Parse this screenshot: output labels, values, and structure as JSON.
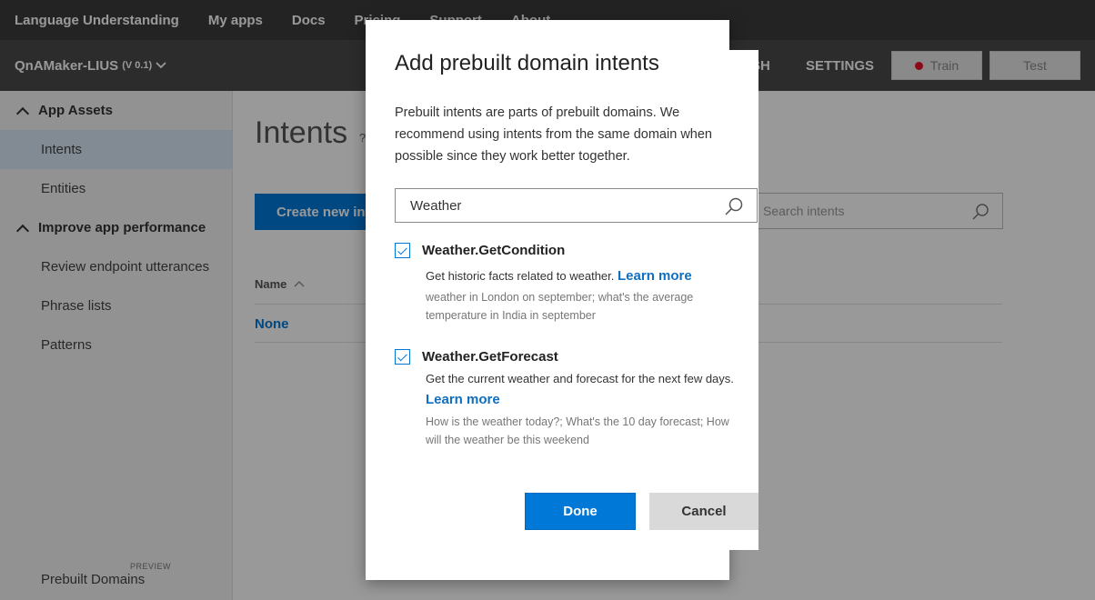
{
  "topnav": {
    "brand": "Language Understanding",
    "items": [
      "My apps",
      "Docs",
      "Pricing",
      "Support",
      "About"
    ]
  },
  "appbar": {
    "app_name": "QnAMaker-LIUS",
    "version": "(V 0.1)",
    "publish_partial": "SH",
    "settings": "SETTINGS",
    "train": "Train",
    "test": "Test"
  },
  "sidebar": {
    "groups": [
      {
        "label": "App Assets",
        "items": [
          "Intents",
          "Entities"
        ]
      },
      {
        "label": "Improve app performance",
        "items": [
          "Review endpoint utterances",
          "Phrase lists",
          "Patterns"
        ]
      }
    ],
    "prebuilt": "Prebuilt Domains",
    "preview_badge": "PREVIEW"
  },
  "main": {
    "title": "Intents",
    "help": "?",
    "create_button": "Create new intent",
    "search_placeholder": "Search intents",
    "column_name": "Name",
    "rows": [
      "None"
    ]
  },
  "dialog": {
    "title": "Add prebuilt domain intents",
    "description": "Prebuilt intents are parts of prebuilt domains. We recommend using intents from the same domain when possible since they work better together.",
    "search_value": "Weather",
    "intents": [
      {
        "name": "Weather.GetCondition",
        "description": "Get historic facts related to weather.",
        "learn_more": "Learn more",
        "examples": "weather in London on september; what's the average temperature in India in september",
        "checked": true
      },
      {
        "name": "Weather.GetForecast",
        "description": "Get the current weather and forecast for the next few days.",
        "learn_more": "Learn more",
        "examples": "How is the weather today?; What's the 10 day forecast; How will the weather be this weekend",
        "checked": true
      }
    ],
    "done_label": "Done",
    "cancel_label": "Cancel"
  },
  "colors": {
    "accent": "#0078d7",
    "link": "#106ebe",
    "topnav": "#3b3b3b",
    "appbar": "#4a4a4a"
  },
  "icons": {
    "search": "search-icon",
    "checkbox": "checkbox-checked-icon",
    "chevron": "chevron-down-icon",
    "record": "record-dot-icon",
    "sort": "sort-up-icon"
  }
}
